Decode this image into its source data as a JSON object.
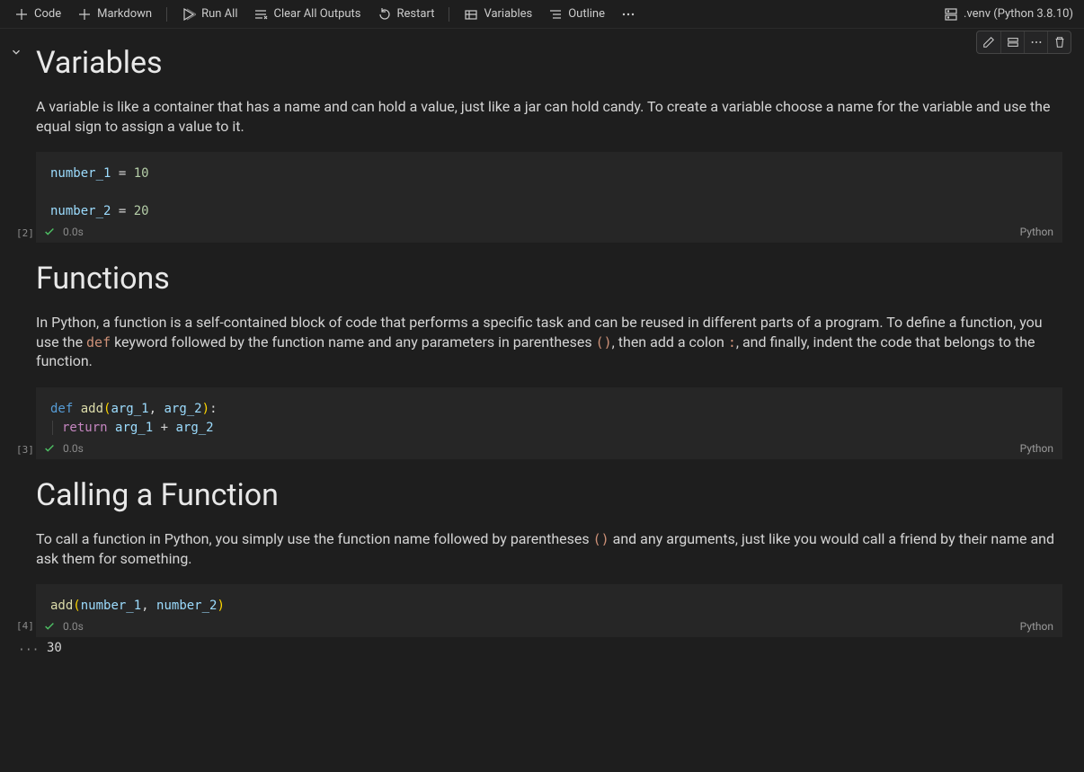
{
  "toolbar": {
    "code": "Code",
    "markdown": "Markdown",
    "run_all": "Run All",
    "clear_outputs": "Clear All Outputs",
    "restart": "Restart",
    "variables": "Variables",
    "outline": "Outline"
  },
  "kernel": {
    "label": ".venv (Python 3.8.10)"
  },
  "sections": {
    "variables": {
      "heading": "Variables",
      "para": "A variable is like a container that has a name and can hold a value, just like a jar can hold candy. To create a variable choose a name for the variable and use the equal sign to assign a value to it."
    },
    "functions": {
      "heading": "Functions",
      "para_a": "In Python, a function is a self-contained block of code that performs a specific task and can be reused in different parts of a program. To define a function, you use the ",
      "kw_def": "def",
      "para_b": " keyword followed by the function name and any parameters in parentheses ",
      "kw_paren": "()",
      "para_c": ", then add a colon ",
      "kw_colon": ":",
      "para_d": ", and finally, indent the code that belongs to the function."
    },
    "calling": {
      "heading": "Calling a Function",
      "para_a": "To call a function in Python, you simply use the function name followed by parentheses ",
      "kw_paren": "()",
      "para_b": " and any arguments, just like you would call a friend by their name and ask them for something."
    }
  },
  "cells": {
    "c2": {
      "index": "[2]",
      "time": "0.0s",
      "lang": "Python",
      "code": {
        "l1_var": "number_1",
        "l1_eq": " = ",
        "l1_val": "10",
        "l2_var": "number_2",
        "l2_eq": " = ",
        "l2_val": "20"
      }
    },
    "c3": {
      "index": "[3]",
      "time": "0.0s",
      "lang": "Python",
      "code": {
        "def": "def ",
        "fn": "add",
        "open": "(",
        "a1": "arg_1",
        "comma": ", ",
        "a2": "arg_2",
        "close": ")",
        "colon": ":",
        "ret": "return ",
        "b1": "arg_1",
        "plus": " + ",
        "b2": "arg_2"
      }
    },
    "c4": {
      "index": "[4]",
      "time": "0.0s",
      "lang": "Python",
      "code": {
        "fn": "add",
        "open": "(",
        "a1": "number_1",
        "comma": ", ",
        "a2": "number_2",
        "close": ")"
      },
      "out_ellipsis": "···",
      "output": "30"
    }
  }
}
